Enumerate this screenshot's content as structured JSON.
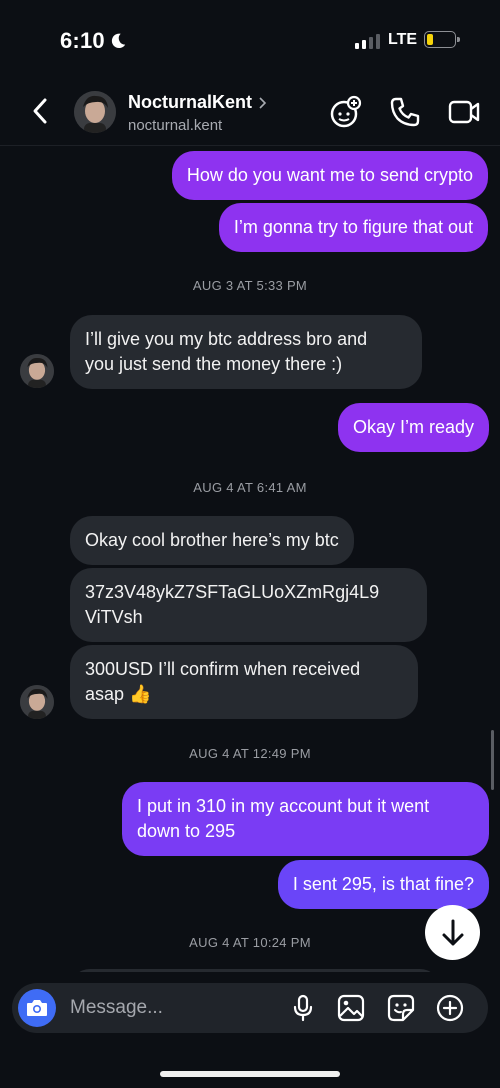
{
  "status_bar": {
    "time": "6:10",
    "network": "LTE"
  },
  "header": {
    "name": "NocturnalKent",
    "username": "nocturnal.kent"
  },
  "messages": [
    {
      "type": "out",
      "text": "How do you want me to send crypto"
    },
    {
      "type": "out",
      "text": "I’m gonna try to figure that out"
    },
    {
      "type": "timestamp",
      "text": "AUG 3 AT 5:33 PM"
    },
    {
      "type": "in",
      "lines": [
        "I’ll give you my btc address bro and",
        "you just send the money there :)"
      ]
    },
    {
      "type": "out",
      "text": "Okay I’m ready"
    },
    {
      "type": "timestamp",
      "text": "AUG 4 AT 6:41 AM"
    },
    {
      "type": "in",
      "text": "Okay cool brother here’s my btc"
    },
    {
      "type": "in",
      "lines": [
        "37z3V48ykZ7SFTaGLUoXZmRgj4L9",
        "ViTVsh"
      ]
    },
    {
      "type": "in",
      "lines": [
        "300USD I’ll confirm when received",
        "asap 👍"
      ]
    },
    {
      "type": "timestamp",
      "text": "AUG 4 AT 12:49 PM"
    },
    {
      "type": "out",
      "lines": [
        "I put in 310 in my account but it went",
        "down to 295"
      ]
    },
    {
      "type": "out",
      "text": "I sent 295, is that fine?"
    },
    {
      "type": "timestamp",
      "text": "AUG 4 AT 10:24 PM"
    }
  ],
  "composer": {
    "placeholder": "Message..."
  },
  "colors": {
    "accent_purple": "#8e33f0",
    "accent_violet": "#6a45f8",
    "camera_blue": "#3f6cf5",
    "incoming_bubble": "#262a30",
    "battery": "#f5d30a"
  },
  "icons": [
    "back-chevron",
    "video-game-icon",
    "phone-icon",
    "video-camera-icon",
    "camera-icon",
    "mic-icon",
    "gallery-icon",
    "sticker-icon",
    "plus-circle-icon",
    "arrow-down-icon",
    "moon-icon"
  ]
}
